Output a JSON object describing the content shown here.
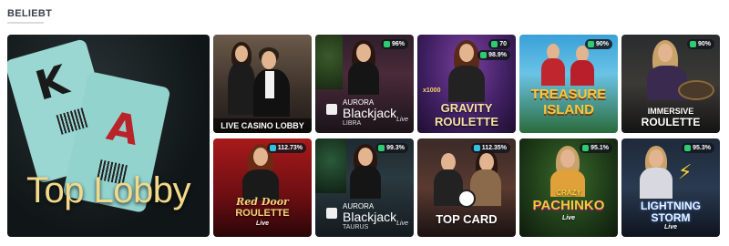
{
  "section": {
    "title": "BELIEBT"
  },
  "tiles": {
    "top_lobby": {
      "title": "Top Lobby"
    },
    "live_casino_lobby": {
      "title": "LIVE CASINO LOBBY"
    },
    "aurora_libra": {
      "brand": "AURORA",
      "title": "Blackjack",
      "subtitle": "LIBRA",
      "live": "Live",
      "rtp": "96%"
    },
    "gravity_roulette": {
      "title_line1": "GRAVITY",
      "title_line2": "ROULETTE",
      "badge1": "70",
      "badge2": "98.9%",
      "multiplier": "x1000"
    },
    "treasure_island": {
      "title_line1": "TREASURE",
      "title_line2": "ISLAND",
      "rtp": "90%"
    },
    "immersive_roulette": {
      "title_line1": "IMMERSIVE",
      "title_line2": "ROULETTE",
      "rtp": "90%"
    },
    "red_door_roulette": {
      "title_line1": "Red Door",
      "title_line2": "ROULETTE",
      "live": "Live",
      "rtp": "112.73%"
    },
    "aurora_taurus": {
      "brand": "AURORA",
      "title": "Blackjack",
      "subtitle": "TAURUS",
      "live": "Live",
      "rtp": "99.3%"
    },
    "top_card": {
      "title": "TOP CARD",
      "rtp": "112.35%"
    },
    "crazy_pachinko": {
      "title_line1": "CRAZY",
      "title_line2": "PACHINKO",
      "live": "Live",
      "rtp": "95.1%"
    },
    "lightning_storm": {
      "title_line1": "LIGHTNING",
      "title_line2": "STORM",
      "live": "Live",
      "rtp": "95.3%"
    }
  }
}
